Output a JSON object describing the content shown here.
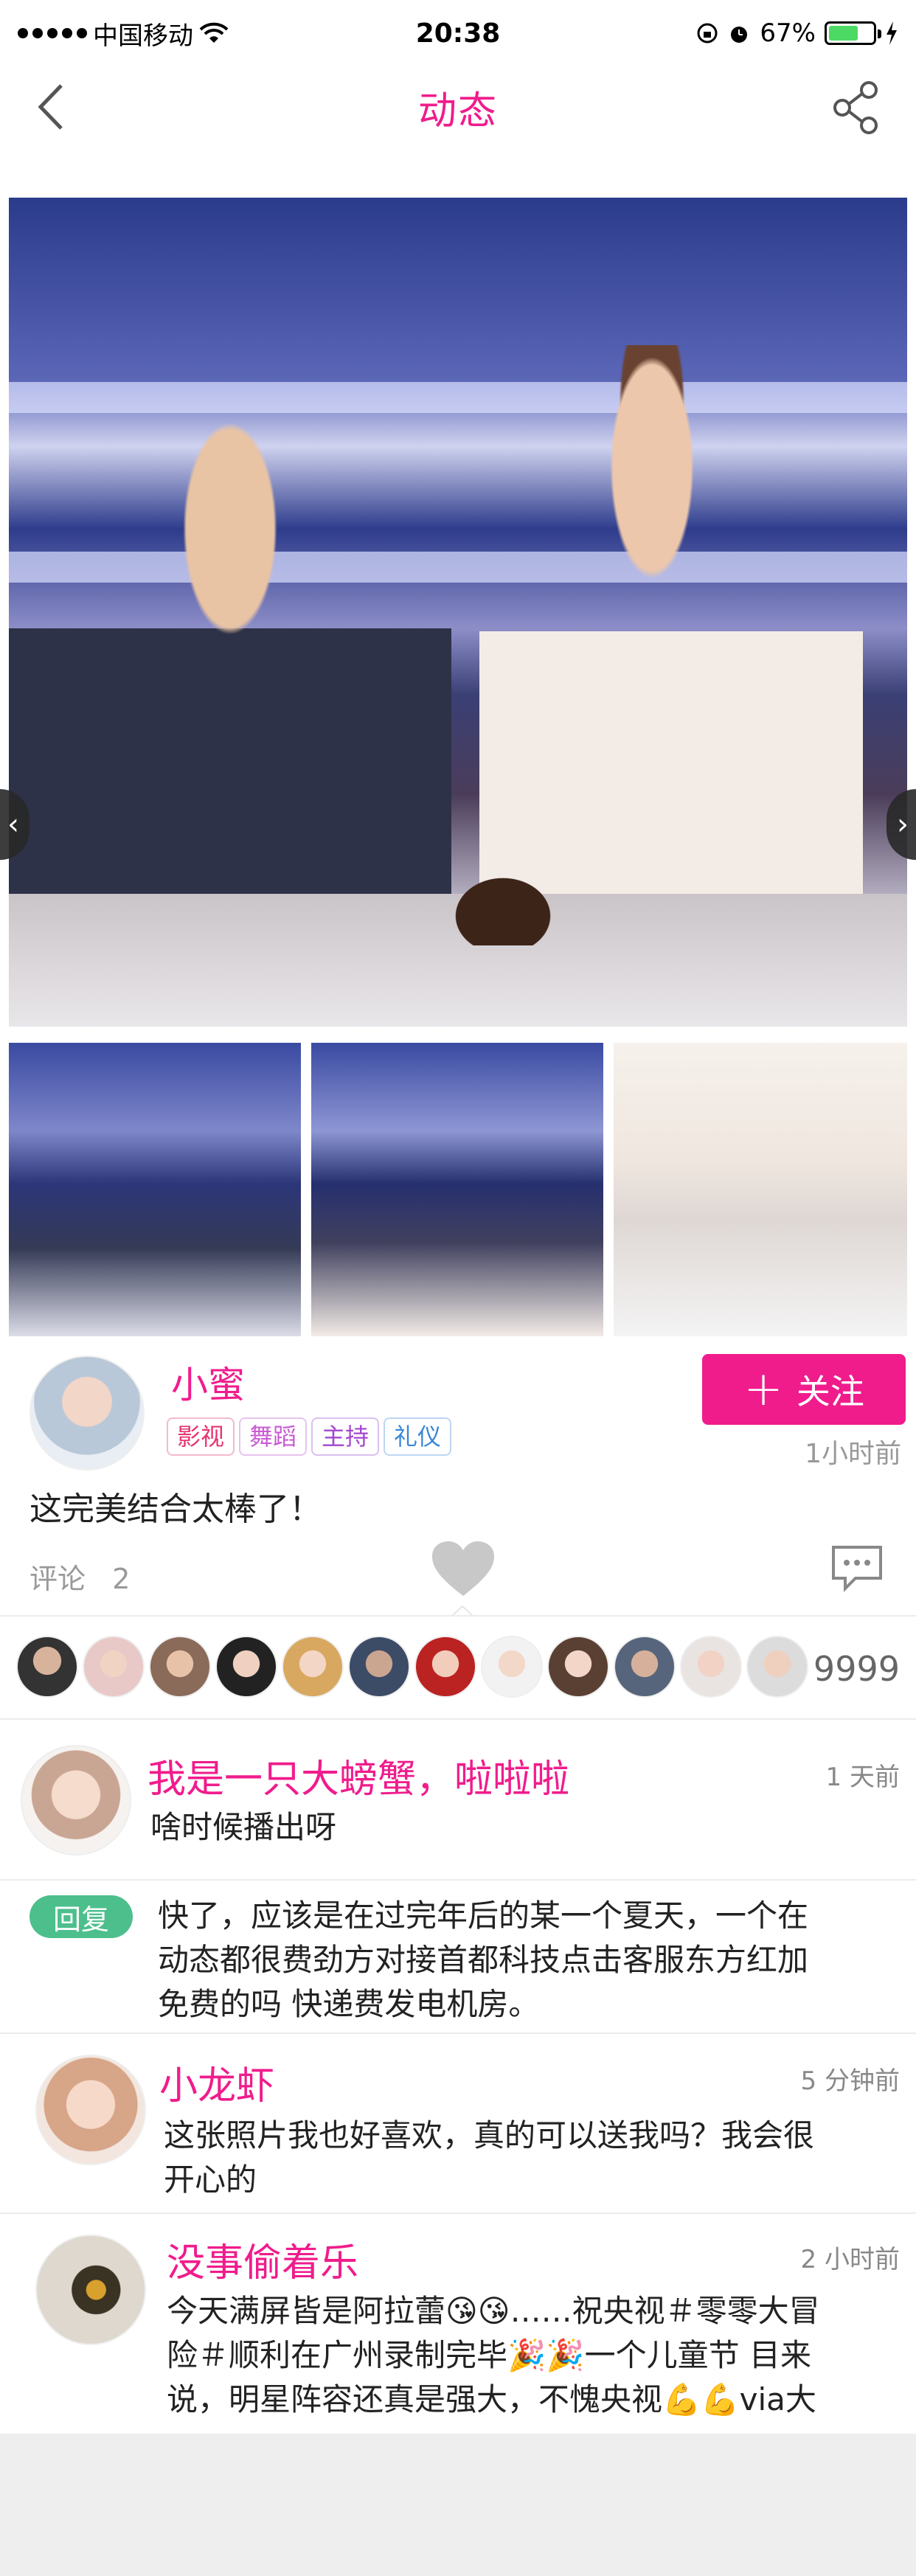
{
  "status_bar": {
    "carrier": "中国移动",
    "time": "20:38",
    "battery": "67%",
    "battery_level": 0.67
  },
  "nav": {
    "title": "动态",
    "back_icon": "chevron-left-icon",
    "share_icon": "share-icon"
  },
  "colors": {
    "accent": "#f01c8c",
    "reply_green": "#4cbf8c"
  },
  "author": {
    "name": "小蜜",
    "tags": [
      "影视",
      "舞蹈",
      "主持",
      "礼仪"
    ],
    "follow_label": "关注",
    "time": "1小时前"
  },
  "post": {
    "text": "这完美结合太棒了！",
    "comment_label": "评论",
    "comment_count": "2",
    "like_count": "9999"
  },
  "comments": [
    {
      "name": "我是一只大螃蟹，啦啦啦",
      "time": "1 天前",
      "text": "啥时候播出呀"
    },
    {
      "reply_label": "回复",
      "text_line1": "快了，应该是在过完年后的某一个夏天，一个在",
      "text_line2": "动态都很费劲方对接首都科技点击客服东方红加",
      "text_line3": "免费的吗 快递费发电机房。"
    },
    {
      "name": "小龙虾",
      "time": "5 分钟前",
      "text_line1": "这张照片我也好喜欢，真的可以送我吗？我会很",
      "text_line2": "开心的"
    },
    {
      "name": "没事偷着乐",
      "time": "2 小时前",
      "text_line1": "今天满屏皆是阿拉蕾😘😘……祝央视＃零零大冒",
      "text_line2": "险＃顺利在广州录制完毕🎉🎉一个儿童节 目来",
      "text_line3": "说，明星阵容还真是强大，不愧央视💪💪via大"
    }
  ]
}
